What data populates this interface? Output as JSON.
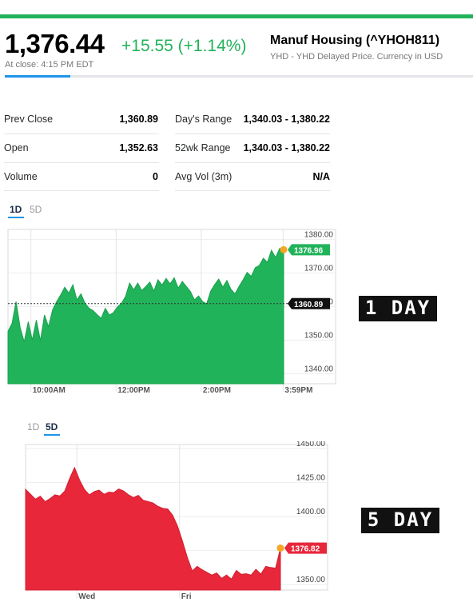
{
  "quote": {
    "price": "1,376.44",
    "change": "+15.55 (+1.14%)",
    "name": "Manuf Housing (^YHOH811)",
    "subtitle": "YHD - YHD Delayed Price. Currency in USD",
    "close_time": "At close: 4:15 PM EDT",
    "colors": {
      "up": "#21b35a",
      "down": "#e8273a",
      "accent": "#1d94e8"
    }
  },
  "stats": {
    "rows": [
      {
        "l1": "Prev Close",
        "v1": "1,360.89",
        "l2": "Day's Range",
        "v2": "1,340.03 - 1,380.22"
      },
      {
        "l1": "Open",
        "v1": "1,352.63",
        "l2": "52wk Range",
        "v2": "1,340.03 - 1,380.22"
      },
      {
        "l1": "Volume",
        "v1": "0",
        "l2": "Avg Vol (3m)",
        "v2": "N/A"
      }
    ]
  },
  "chart1": {
    "tabs": [
      "1D",
      "5D"
    ],
    "active_tab": "1D",
    "badge_last": "1376.96",
    "badge_prev": "1360.89",
    "side_label": "1 DAY"
  },
  "chart2": {
    "tabs": [
      "1D",
      "5D"
    ],
    "active_tab": "5D",
    "badge_last": "1376.82",
    "side_label": "5 DAY"
  },
  "chart_data": [
    {
      "type": "area",
      "period": "1D",
      "ylim": [
        1337,
        1383
      ],
      "yticks": [
        "1380.00",
        "1370.00",
        "1360.00",
        "1350.00",
        "1340.00"
      ],
      "ytick_values": [
        1380,
        1370,
        1360,
        1350,
        1340
      ],
      "xticks": [
        "10:00AM",
        "12:00PM",
        "2:00PM",
        "3:59PM"
      ],
      "reference_line": 1360.89,
      "last": 1376.96,
      "color": "#21b35a",
      "values": [
        1352.6,
        1355.0,
        1361.5,
        1353.8,
        1349.5,
        1355.5,
        1350.0,
        1356.0,
        1349.8,
        1357.5,
        1354.0,
        1359.0,
        1361.5,
        1363.5,
        1365.8,
        1364.0,
        1366.5,
        1362.0,
        1363.8,
        1361.0,
        1359.5,
        1358.8,
        1357.6,
        1356.5,
        1359.5,
        1357.5,
        1358.2,
        1359.9,
        1361.0,
        1363.0,
        1367.0,
        1365.0,
        1367.0,
        1364.8,
        1366.0,
        1367.3,
        1364.6,
        1368.0,
        1366.4,
        1368.4,
        1366.8,
        1368.6,
        1365.5,
        1367.5,
        1366.0,
        1364.5,
        1362.0,
        1363.2,
        1361.5,
        1360.8,
        1364.6,
        1366.6,
        1368.2,
        1365.8,
        1367.8,
        1365.2,
        1363.8,
        1366.0,
        1368.0,
        1370.2,
        1369.0,
        1371.6,
        1372.3,
        1374.4,
        1373.2,
        1376.8,
        1374.6,
        1377.3,
        1376.96
      ]
    },
    {
      "type": "area",
      "period": "5D",
      "ylim": [
        1346,
        1453
      ],
      "yticks": [
        "1450.00",
        "1425.00",
        "1400.00",
        "1375.00",
        "1350.00"
      ],
      "ytick_values": [
        1450,
        1425,
        1400,
        1375,
        1350
      ],
      "xticks": [
        "Wed",
        "Fri"
      ],
      "last": 1376.82,
      "color": "#e8273a",
      "values": [
        1420.0,
        1416.5,
        1412.8,
        1415.0,
        1411.0,
        1413.2,
        1416.0,
        1415.2,
        1418.8,
        1428.0,
        1436.0,
        1427.0,
        1420.0,
        1416.0,
        1418.4,
        1419.5,
        1416.4,
        1418.0,
        1417.6,
        1420.3,
        1418.8,
        1416.0,
        1414.0,
        1415.6,
        1412.0,
        1411.0,
        1410.0,
        1407.5,
        1406.0,
        1405.6,
        1401.0,
        1393.0,
        1382.0,
        1370.0,
        1360.0,
        1363.4,
        1361.0,
        1359.0,
        1357.0,
        1358.5,
        1354.5,
        1357.0,
        1354.0,
        1360.4,
        1357.5,
        1358.0,
        1357.0,
        1361.2,
        1357.7,
        1363.4,
        1362.6,
        1362.0,
        1376.82
      ]
    }
  ]
}
